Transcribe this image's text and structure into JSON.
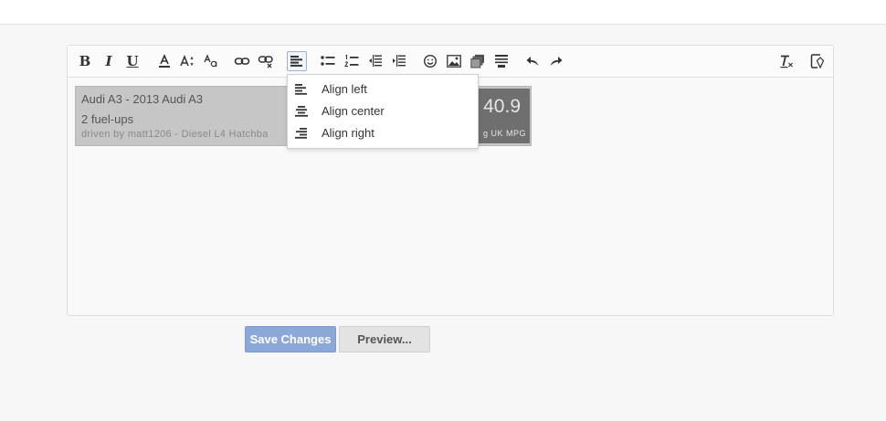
{
  "editor": {
    "toolbar": {
      "buttons": [
        {
          "name": "bold",
          "label": "B"
        },
        {
          "name": "italic",
          "label": "I"
        },
        {
          "name": "underline",
          "label": "U"
        }
      ]
    },
    "widget": {
      "title": "Audi A3 - 2013 Audi A3",
      "fuelups": "2 fuel-ups",
      "driven": "driven by matt1206 - Diesel L4 Hatchba",
      "mpg_value": "40.9",
      "mpg_unit": "g UK MPG"
    },
    "align_menu": {
      "items": [
        {
          "label": "Align left",
          "icon": "align-left-icon"
        },
        {
          "label": "Align center",
          "icon": "align-center-icon"
        },
        {
          "label": "Align right",
          "icon": "align-right-icon"
        }
      ]
    }
  },
  "actions": {
    "save_label": "Save Changes",
    "preview_label": "Preview..."
  },
  "colors": {
    "save": "#8ca8d8",
    "preview": "#e3e3e3",
    "mpg_box": "#6f6f6f"
  }
}
